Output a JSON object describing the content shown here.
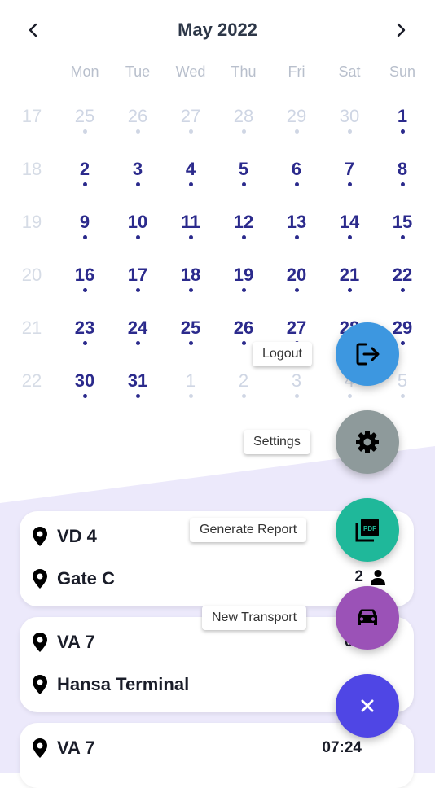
{
  "header": {
    "month_year": "May 2022"
  },
  "weekdays": [
    "Mon",
    "Tue",
    "Wed",
    "Thu",
    "Fri",
    "Sat",
    "Sun"
  ],
  "calendar": {
    "weeks": [
      {
        "week": "17",
        "days": [
          {
            "d": "25",
            "muted": true
          },
          {
            "d": "26",
            "muted": true
          },
          {
            "d": "27",
            "muted": true
          },
          {
            "d": "28",
            "muted": true
          },
          {
            "d": "29",
            "muted": true
          },
          {
            "d": "30",
            "muted": true
          },
          {
            "d": "1",
            "muted": false
          }
        ]
      },
      {
        "week": "18",
        "days": [
          {
            "d": "2",
            "muted": false
          },
          {
            "d": "3",
            "muted": false
          },
          {
            "d": "4",
            "muted": false
          },
          {
            "d": "5",
            "muted": false
          },
          {
            "d": "6",
            "muted": false
          },
          {
            "d": "7",
            "muted": false
          },
          {
            "d": "8",
            "muted": false
          }
        ]
      },
      {
        "week": "19",
        "days": [
          {
            "d": "9",
            "muted": false
          },
          {
            "d": "10",
            "muted": false
          },
          {
            "d": "11",
            "muted": false
          },
          {
            "d": "12",
            "muted": false
          },
          {
            "d": "13",
            "muted": false
          },
          {
            "d": "14",
            "muted": false
          },
          {
            "d": "15",
            "muted": false
          }
        ]
      },
      {
        "week": "20",
        "days": [
          {
            "d": "16",
            "muted": false
          },
          {
            "d": "17",
            "muted": false
          },
          {
            "d": "18",
            "muted": false
          },
          {
            "d": "19",
            "muted": false
          },
          {
            "d": "20",
            "muted": false
          },
          {
            "d": "21",
            "muted": false
          },
          {
            "d": "22",
            "muted": false
          }
        ]
      },
      {
        "week": "21",
        "days": [
          {
            "d": "23",
            "muted": false
          },
          {
            "d": "24",
            "muted": false
          },
          {
            "d": "25",
            "muted": false
          },
          {
            "d": "26",
            "muted": false
          },
          {
            "d": "27",
            "muted": false
          },
          {
            "d": "28",
            "muted": false
          },
          {
            "d": "29",
            "muted": false
          }
        ]
      },
      {
        "week": "22",
        "days": [
          {
            "d": "30",
            "muted": false
          },
          {
            "d": "31",
            "muted": false
          },
          {
            "d": "1",
            "muted": true
          },
          {
            "d": "2",
            "muted": true
          },
          {
            "d": "3",
            "muted": true
          },
          {
            "d": "4",
            "muted": true
          },
          {
            "d": "5",
            "muted": true
          }
        ]
      }
    ]
  },
  "transports": [
    {
      "from": "VD 4",
      "to": "Gate C",
      "time": "",
      "passengers": "2"
    },
    {
      "from": "VA 7",
      "to": "Hansa Terminal",
      "time": "07",
      "passengers": ""
    },
    {
      "from": "VA 7",
      "to": "",
      "time": "07:24",
      "passengers": ""
    }
  ],
  "menu": {
    "logout_label": "Logout",
    "settings_label": "Settings",
    "report_label": "Generate Report",
    "new_transport_label": "New Transport",
    "close_icon": "close-icon"
  },
  "colors": {
    "accent": "#2b2a8c",
    "logout": "#3d97e0",
    "settings": "#8e9a9b",
    "report": "#1fb89a",
    "transport": "#9b52b7",
    "close": "#4f46e5"
  }
}
